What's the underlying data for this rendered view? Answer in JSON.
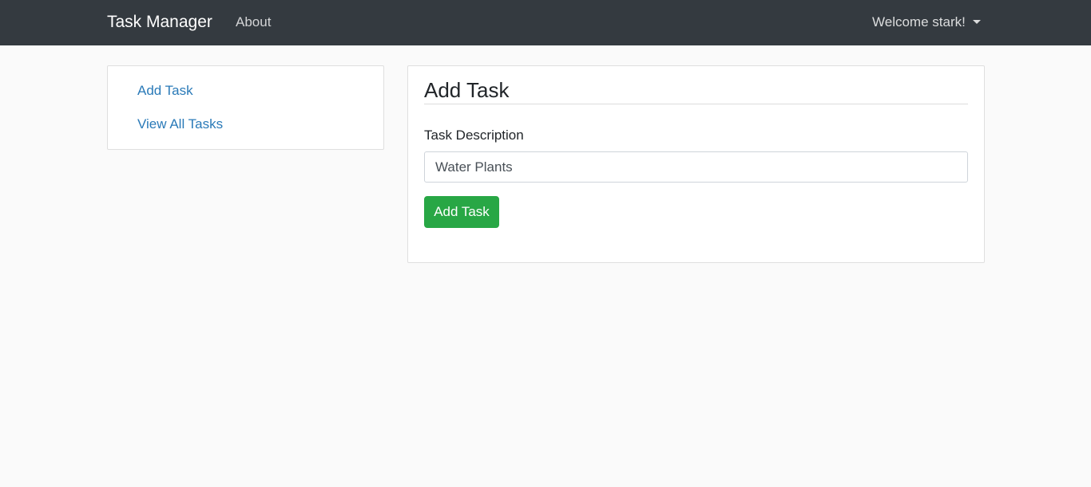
{
  "navbar": {
    "brand": "Task Manager",
    "about_label": "About",
    "user_menu_label": "Welcome stark!"
  },
  "sidebar": {
    "items": [
      {
        "label": "Add Task"
      },
      {
        "label": "View All Tasks"
      }
    ]
  },
  "main": {
    "title": "Add Task",
    "task_description_label": "Task Description",
    "task_description_value": "Water Plants",
    "submit_label": "Add Task"
  },
  "colors": {
    "navbar_bg": "#343a40",
    "link": "#2a7ab8",
    "success_button": "#28a745",
    "page_bg": "#fafafa"
  }
}
